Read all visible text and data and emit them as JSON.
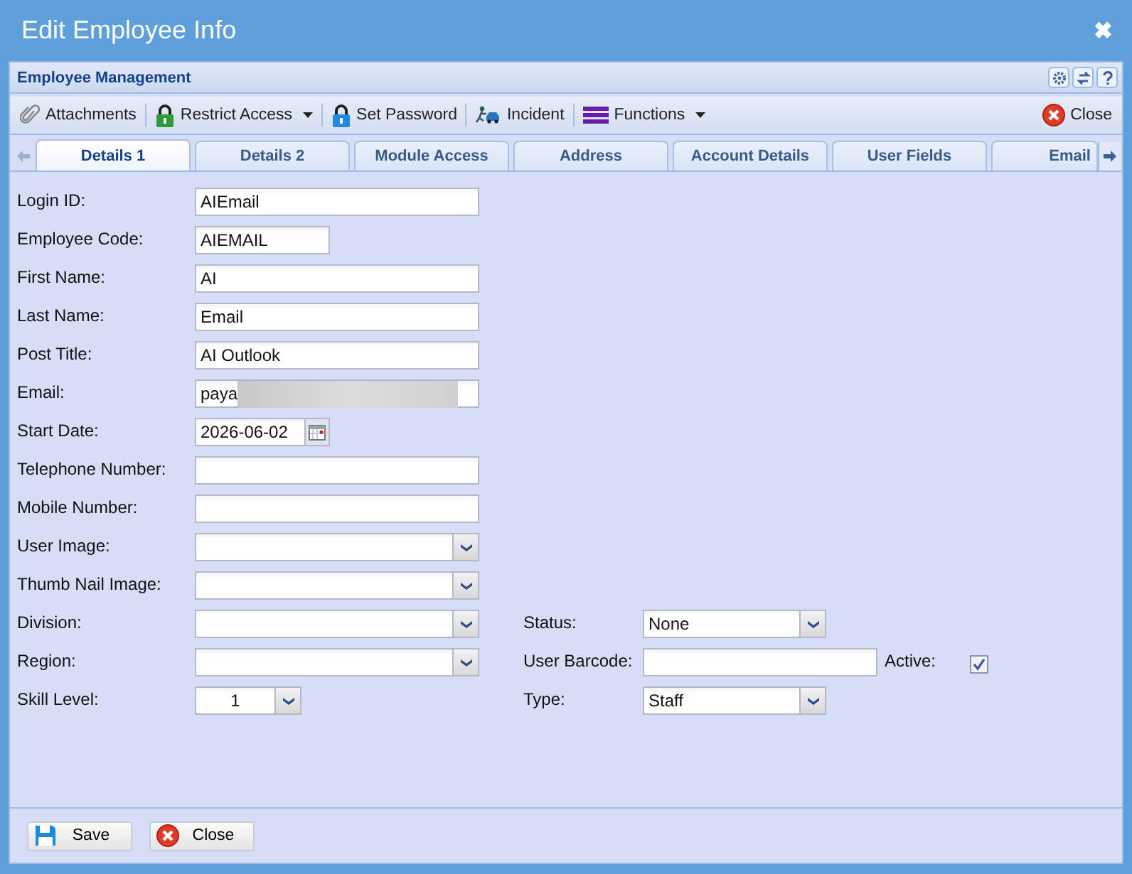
{
  "window": {
    "title": "Edit Employee Info",
    "close": "✖"
  },
  "panel": {
    "title": "Employee Management"
  },
  "toolbar": [
    {
      "label": "Attachments",
      "dropdown": false
    },
    {
      "label": "Restrict Access",
      "dropdown": true
    },
    {
      "label": "Set Password",
      "dropdown": false
    },
    {
      "label": "Incident",
      "dropdown": false
    },
    {
      "label": "Functions",
      "dropdown": true
    }
  ],
  "toolbar_close": "Close",
  "tabs": [
    {
      "label": "Details 1",
      "selected": true
    },
    {
      "label": "Details 2",
      "selected": false
    },
    {
      "label": "Module Access",
      "selected": false
    },
    {
      "label": "Address",
      "selected": false
    },
    {
      "label": "Account Details",
      "selected": false
    },
    {
      "label": "User Fields",
      "selected": false
    },
    {
      "label": "Email",
      "selected": false
    }
  ],
  "fields": [
    {
      "label": "Login ID:",
      "kind": "text",
      "value": "AIEmail"
    },
    {
      "label": "Employee Code:",
      "kind": "short",
      "value": "AIEMAIL"
    },
    {
      "label": "First Name:",
      "kind": "text",
      "value": "AI"
    },
    {
      "label": "Last Name:",
      "kind": "text",
      "value": "Email"
    },
    {
      "label": "Post Title:",
      "kind": "text",
      "value": "AI Outlook"
    },
    {
      "label": "Email:",
      "kind": "redacted",
      "value": "paya"
    },
    {
      "label": "Start Date:",
      "kind": "date",
      "value": "2026-06-02"
    },
    {
      "label": "Telephone Number:",
      "kind": "text"
    },
    {
      "label": "Mobile Number:",
      "kind": "text"
    },
    {
      "label": "User Image:",
      "kind": "select"
    },
    {
      "label": "Thumb Nail Image:",
      "kind": "select"
    },
    {
      "label": "Division:",
      "kind": "select"
    },
    {
      "label": "Region:",
      "kind": "select"
    },
    {
      "label": "Skill Level:",
      "kind": "small-select",
      "value": "1"
    }
  ],
  "right_fields": [
    {
      "label": "Status:",
      "kind": "select",
      "value": "None"
    },
    {
      "label": "User Barcode:",
      "kind": "text",
      "checkbox_label": "Active:",
      "checked": true
    },
    {
      "label": "Type:",
      "kind": "select",
      "value": "Staff"
    }
  ],
  "buttons": [
    {
      "label": "Save"
    },
    {
      "label": "Close"
    }
  ]
}
